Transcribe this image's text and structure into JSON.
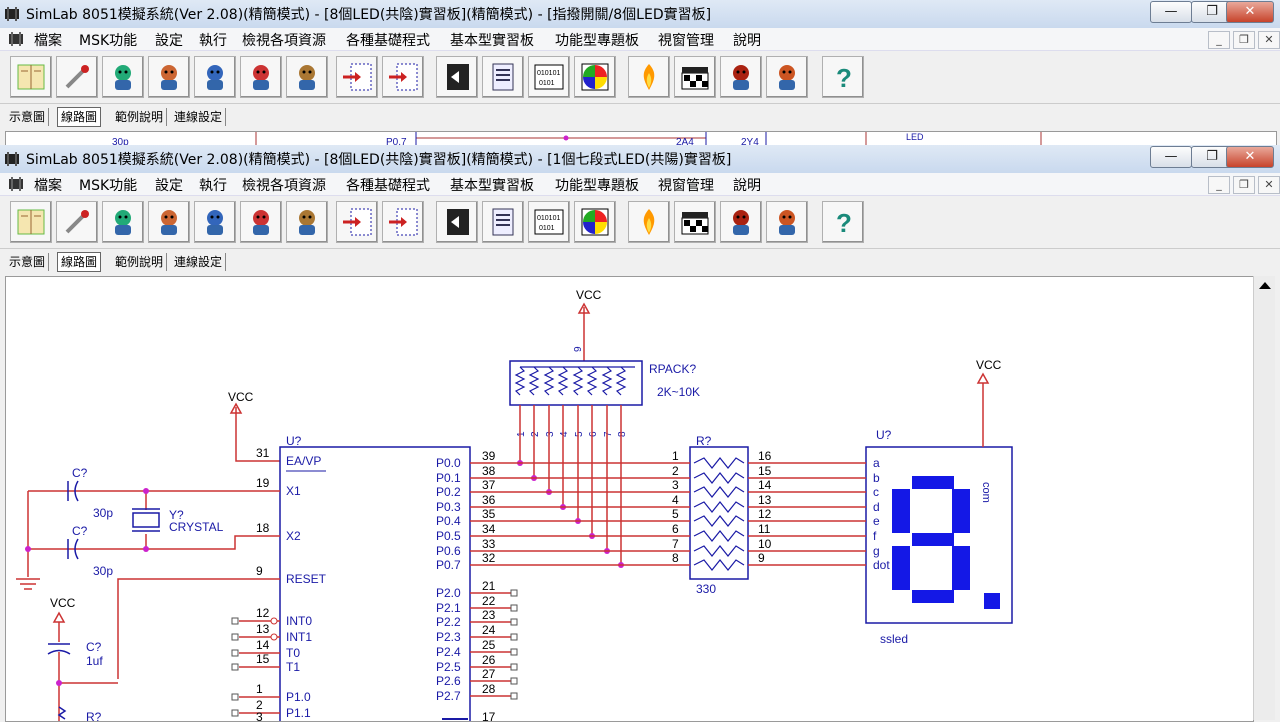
{
  "back_window": {
    "title": "SimLab 8051模擬系統(Ver  2.08)(精簡模式) - [8個LED(共陰)實習板](精簡模式) - [指撥開關/8個LED實習板]",
    "strip_labels": [
      "30p",
      "P0.7",
      "2A4",
      "2Y4",
      "LED"
    ]
  },
  "front_window": {
    "title": "SimLab 8051模擬系統(Ver  2.08)(精簡模式) - [8個LED(共陰)實習板](精簡模式) - [1個七段式LED(共陽)實習板]"
  },
  "menu": [
    "檔案",
    "MSK功能",
    "設定",
    "執行",
    "檢視各項資源",
    "各種基礎程式",
    "基本型實習板",
    "功能型專題板",
    "視窗管理",
    "說明"
  ],
  "caption_buttons": {
    "minimize": "—",
    "restore": "❐",
    "close": "✕"
  },
  "mdi_buttons": {
    "minimize": "_",
    "restore": "❐",
    "close": "✕"
  },
  "toolbar_icons": [
    "book-icon",
    "wrench-icon",
    "character-1-icon",
    "character-2-icon",
    "character-3-icon",
    "character-4-icon",
    "character-5-icon",
    "load-code-icon",
    "load-data-icon",
    "chip-icon",
    "document-icon",
    "binary-memory-icon",
    "color-palette-icon",
    "flame-icon",
    "clapper-icon",
    "grenade-icon",
    "hand-icon",
    "help-icon"
  ],
  "tabs": [
    "示意圖",
    "線路圖",
    "範例說明",
    "連線設定"
  ],
  "active_tab": "線路圖",
  "schematic": {
    "vcc": "VCC",
    "rpack_label": "RPACK?",
    "rpack_value": "2K~10K",
    "rpack_pin_top": "9",
    "rpack_pins_bottom": [
      "1",
      "2",
      "3",
      "4",
      "5",
      "6",
      "7",
      "8"
    ],
    "mcu_ref": "U?",
    "mcu_left_pins": [
      {
        "num": "31",
        "name": "EA/VP"
      },
      {
        "num": "19",
        "name": "X1"
      },
      {
        "num": "18",
        "name": "X2"
      },
      {
        "num": "9",
        "name": "RESET"
      },
      {
        "num": "12",
        "name": "INT0"
      },
      {
        "num": "13",
        "name": "INT1"
      },
      {
        "num": "14",
        "name": "T0"
      },
      {
        "num": "15",
        "name": "T1"
      },
      {
        "num": "1",
        "name": "P1.0"
      },
      {
        "num": "2",
        "name": "P1.1"
      },
      {
        "num": "3",
        "name": ""
      }
    ],
    "mcu_p0_pins": [
      {
        "name": "P0.0",
        "num": "39"
      },
      {
        "name": "P0.1",
        "num": "38"
      },
      {
        "name": "P0.2",
        "num": "37"
      },
      {
        "name": "P0.3",
        "num": "36"
      },
      {
        "name": "P0.4",
        "num": "35"
      },
      {
        "name": "P0.5",
        "num": "34"
      },
      {
        "name": "P0.6",
        "num": "33"
      },
      {
        "name": "P0.7",
        "num": "32"
      }
    ],
    "mcu_p2_pins": [
      {
        "name": "P2.0",
        "num": "21"
      },
      {
        "name": "P2.1",
        "num": "22"
      },
      {
        "name": "P2.2",
        "num": "23"
      },
      {
        "name": "P2.3",
        "num": "24"
      },
      {
        "name": "P2.4",
        "num": "25"
      },
      {
        "name": "P2.5",
        "num": "26"
      },
      {
        "name": "P2.6",
        "num": "27"
      },
      {
        "name": "P2.7",
        "num": "28"
      }
    ],
    "mcu_bottom_pin": "17",
    "cap1_ref": "C?",
    "cap1_val": "30p",
    "cap2_ref": "C?",
    "cap2_val": "30p",
    "crystal_ref": "Y?",
    "crystal_val": "CRYSTAL",
    "cap3_ref": "C?",
    "cap3_val": "1uf",
    "res_bottom_ref": "R?",
    "resistor_ref": "R?",
    "resistor_value": "330",
    "resistor_left_pins": [
      "1",
      "2",
      "3",
      "4",
      "5",
      "6",
      "7",
      "8"
    ],
    "resistor_right_pins": [
      "16",
      "15",
      "14",
      "13",
      "12",
      "11",
      "10",
      "9"
    ],
    "seg_ref": "U?",
    "seg_pins": [
      "a",
      "b",
      "c",
      "d",
      "e",
      "f",
      "g",
      "dot"
    ],
    "seg_com": "com",
    "seg_label": "ssled"
  }
}
